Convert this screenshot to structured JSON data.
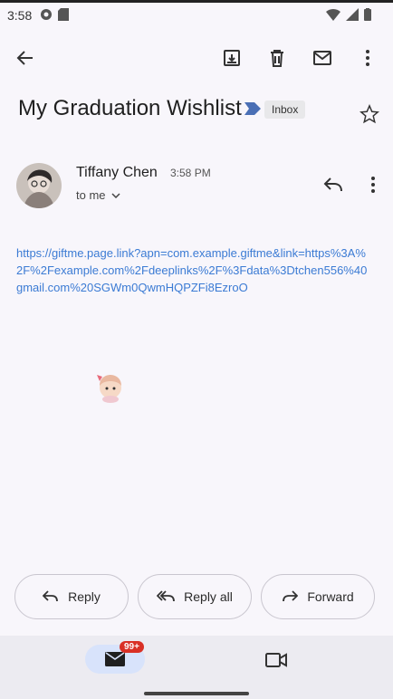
{
  "status_bar": {
    "time": "3:58"
  },
  "subject": {
    "title": "My Graduation Wishlist",
    "label": "Inbox"
  },
  "sender": {
    "name": "Tiffany Chen",
    "time": "3:58 PM",
    "to": "to me"
  },
  "body": {
    "link": "https://giftme.page.link?apn=com.example.giftme&link=https%3A%2F%2Fexample.com%2Fdeeplinks%2F%3Fdata%3Dtchen556%40gmail.com%20SGWm0QwmHQPZFi8EzroO"
  },
  "actions": {
    "reply": "Reply",
    "reply_all": "Reply all",
    "forward": "Forward"
  },
  "nav": {
    "mail_badge": "99+"
  },
  "colors": {
    "link": "#3b7bd4",
    "badge": "#d93025",
    "nav_active": "#d8e3fb"
  }
}
